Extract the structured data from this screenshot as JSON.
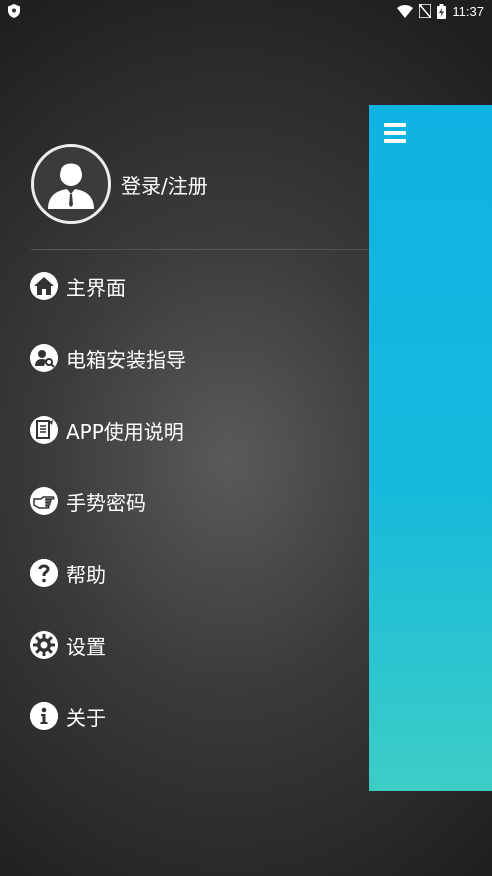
{
  "status_bar": {
    "time": "11:37",
    "icons": [
      "shield-icon",
      "wifi-icon",
      "no-sim-icon",
      "battery-charging-icon"
    ]
  },
  "drawer": {
    "profile": {
      "label": "登录/注册",
      "icon": "user-avatar-icon"
    },
    "items": [
      {
        "label": "主界面",
        "icon": "home-icon"
      },
      {
        "label": "电箱安装指导",
        "icon": "user-search-icon"
      },
      {
        "label": "APP使用说明",
        "icon": "document-icon"
      },
      {
        "label": "手势密码",
        "icon": "hand-pointing-icon"
      },
      {
        "label": "帮助",
        "icon": "question-icon"
      },
      {
        "label": "设置",
        "icon": "gear-icon"
      },
      {
        "label": "关于",
        "icon": "info-icon"
      }
    ]
  },
  "main_panel": {
    "menu_icon": "hamburger-icon",
    "accent_top": "#0fb3e3",
    "accent_bottom": "#3ccdc6"
  }
}
